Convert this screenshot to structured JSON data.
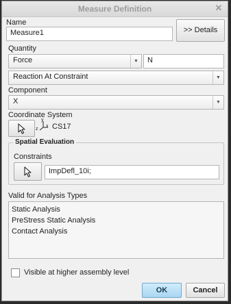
{
  "window": {
    "title": "Measure Definition",
    "close_icon": "close-icon"
  },
  "name": {
    "label": "Name",
    "value": "Measure1"
  },
  "details_button": ">> Details",
  "quantity": {
    "label": "Quantity",
    "selected": "Force",
    "unit": "N",
    "subtype": "Reaction At Constraint"
  },
  "component": {
    "label": "Component",
    "selected": "X"
  },
  "coordinate_system": {
    "label": "Coordinate System",
    "axis_y": "y",
    "axis_z": "z",
    "axis_x": "x",
    "value": "CS17"
  },
  "spatial_evaluation": {
    "title": "Spatial Evaluation",
    "constraints_label": "Constraints",
    "constraints_value": "ImpDefl_10i;"
  },
  "analysis_types": {
    "label": "Valid for Analysis Types",
    "items": [
      "Static Analysis",
      "PreStress Static Analysis",
      "Contact Analysis"
    ]
  },
  "visible_checkbox": {
    "label": "Visible at higher assembly level",
    "checked": false
  },
  "buttons": {
    "ok": "OK",
    "cancel": "Cancel"
  }
}
